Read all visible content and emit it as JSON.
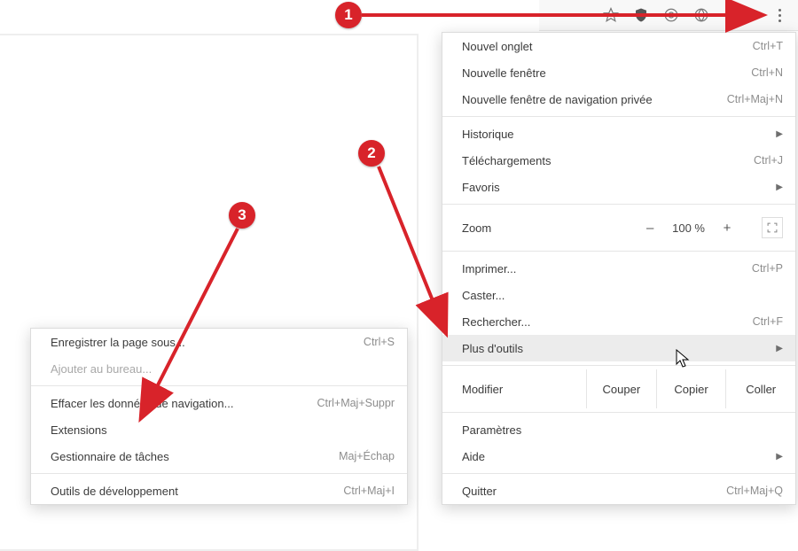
{
  "toolbar": {
    "icons": [
      "star-icon",
      "shield-icon",
      "target-icon",
      "globe-icon",
      "lock-icon",
      "dots-icon"
    ]
  },
  "menu": {
    "new_tab": "Nouvel onglet",
    "new_tab_sc": "Ctrl+T",
    "new_window": "Nouvelle fenêtre",
    "new_window_sc": "Ctrl+N",
    "incognito": "Nouvelle fenêtre de navigation privée",
    "incognito_sc": "Ctrl+Maj+N",
    "history": "Historique",
    "downloads": "Téléchargements",
    "downloads_sc": "Ctrl+J",
    "bookmarks": "Favoris",
    "zoom": "Zoom",
    "zoom_minus": "–",
    "zoom_val": "100 %",
    "zoom_plus": "+",
    "print": "Imprimer...",
    "print_sc": "Ctrl+P",
    "cast": "Caster...",
    "find": "Rechercher...",
    "find_sc": "Ctrl+F",
    "more_tools": "Plus d'outils",
    "edit": "Modifier",
    "cut": "Couper",
    "copy": "Copier",
    "paste": "Coller",
    "settings": "Paramètres",
    "help": "Aide",
    "quit": "Quitter",
    "quit_sc": "Ctrl+Maj+Q"
  },
  "submenu": {
    "save_as": "Enregistrer la page sous...",
    "save_as_sc": "Ctrl+S",
    "add_desktop": "Ajouter au bureau...",
    "clear_data": "Effacer les données de navigation...",
    "clear_data_sc": "Ctrl+Maj+Suppr",
    "extensions": "Extensions",
    "task_manager": "Gestionnaire de tâches",
    "task_manager_sc": "Maj+Échap",
    "dev_tools": "Outils de développement",
    "dev_tools_sc": "Ctrl+Maj+I"
  },
  "badges": {
    "one": "1",
    "two": "2",
    "three": "3"
  }
}
